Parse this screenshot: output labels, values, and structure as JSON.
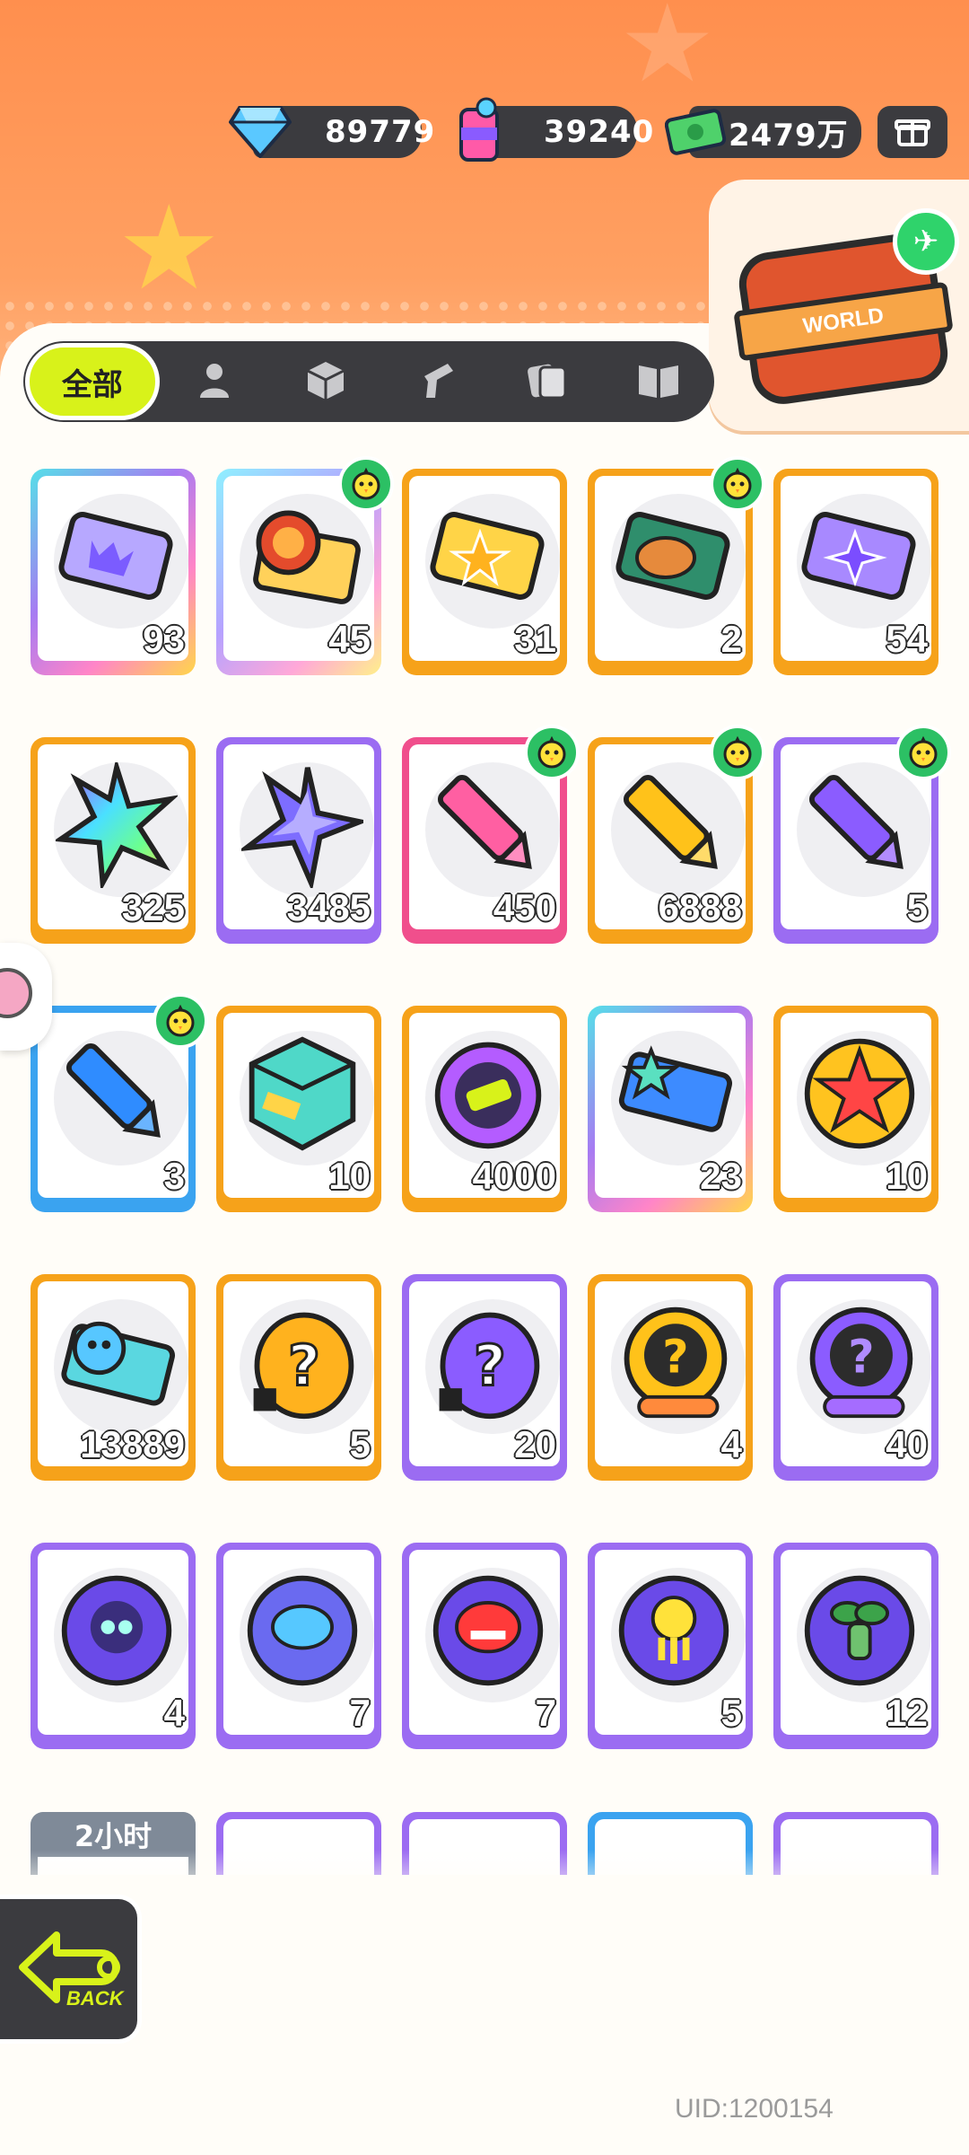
{
  "currencies": {
    "diamond": {
      "icon": "diamond-icon",
      "value": "89779"
    },
    "paint": {
      "icon": "paint-can-icon",
      "value": "39240"
    },
    "cash": {
      "icon": "cash-icon",
      "value": "2479万"
    }
  },
  "settings_icon": "gift-box-icon",
  "travel": {
    "label": "WORLD",
    "icon": "plane-icon"
  },
  "tabs": [
    {
      "label": "全部",
      "icon": null,
      "active": true
    },
    {
      "label": "",
      "icon": "person-icon"
    },
    {
      "label": "",
      "icon": "box-icon"
    },
    {
      "label": "",
      "icon": "paint-gun-icon"
    },
    {
      "label": "",
      "icon": "cards-icon"
    },
    {
      "label": "",
      "icon": "book-icon"
    }
  ],
  "items": [
    {
      "name": "purple-ticket",
      "count": "93",
      "frame": "c-rainbow",
      "badge": false,
      "icon": "ticket-crown-icon"
    },
    {
      "name": "lion-ticket",
      "count": "45",
      "frame": "c-rainbow2",
      "badge": true,
      "icon": "lion-ticket-icon"
    },
    {
      "name": "gold-ticket",
      "count": "31",
      "frame": "c-orange",
      "badge": false,
      "icon": "star-ticket-icon"
    },
    {
      "name": "bread-ticket",
      "count": "2",
      "frame": "c-orange",
      "badge": true,
      "icon": "bread-ticket-icon"
    },
    {
      "name": "violet-ticket",
      "count": "54",
      "frame": "c-orange",
      "badge": false,
      "icon": "sparkle-ticket-icon"
    },
    {
      "name": "rainbow-star",
      "count": "325",
      "frame": "c-orange",
      "badge": false,
      "icon": "rainbow-star-icon"
    },
    {
      "name": "purple-star",
      "count": "3485",
      "frame": "c-purple",
      "badge": false,
      "icon": "purple-star-icon"
    },
    {
      "name": "pink-crayon",
      "count": "450",
      "frame": "c-pink",
      "badge": true,
      "icon": "pink-crayon-icon"
    },
    {
      "name": "yellow-crayon",
      "count": "6888",
      "frame": "c-orange",
      "badge": true,
      "icon": "yellow-crayon-icon"
    },
    {
      "name": "purple-crayon",
      "count": "5",
      "frame": "c-purple",
      "badge": true,
      "icon": "purple-crayon-icon"
    },
    {
      "name": "blue-crayon",
      "count": "3",
      "frame": "c-blue",
      "badge": true,
      "icon": "blue-crayon-icon"
    },
    {
      "name": "color-block",
      "count": "10",
      "frame": "c-orange",
      "badge": false,
      "icon": "color-block-icon"
    },
    {
      "name": "cool-badge",
      "count": "4000",
      "frame": "c-orange",
      "badge": false,
      "icon": "cool-badge-icon"
    },
    {
      "name": "lottery-ticket",
      "count": "23",
      "frame": "c-rainbow",
      "badge": false,
      "icon": "lottery-ticket-icon"
    },
    {
      "name": "star-badge",
      "count": "10",
      "frame": "c-orange",
      "badge": false,
      "icon": "star-badge-icon"
    },
    {
      "name": "season-ticket",
      "count": "13889",
      "frame": "c-orange",
      "badge": false,
      "icon": "season-ticket-icon"
    },
    {
      "name": "gold-egg",
      "count": "5",
      "frame": "c-orange",
      "badge": false,
      "icon": "mystery-egg-gold-icon"
    },
    {
      "name": "purple-egg",
      "count": "20",
      "frame": "c-purple",
      "badge": false,
      "icon": "mystery-egg-purple-icon"
    },
    {
      "name": "gold-deity",
      "count": "4",
      "frame": "c-orange",
      "badge": false,
      "icon": "deity-gold-icon"
    },
    {
      "name": "purple-deity",
      "count": "40",
      "frame": "c-purple",
      "badge": false,
      "icon": "deity-purple-icon"
    },
    {
      "name": "bat-pet-orb",
      "count": "4",
      "frame": "c-purple",
      "badge": false,
      "icon": "bat-orb-icon"
    },
    {
      "name": "fish-pet-orb",
      "count": "7",
      "frame": "c-purple",
      "badge": false,
      "icon": "fish-orb-icon"
    },
    {
      "name": "piranha-pet-orb",
      "count": "7",
      "frame": "c-purple",
      "badge": false,
      "icon": "piranha-orb-icon"
    },
    {
      "name": "jelly-pet-orb",
      "count": "5",
      "frame": "c-purple",
      "badge": false,
      "icon": "jelly-orb-icon"
    },
    {
      "name": "sprout-pet-orb",
      "count": "12",
      "frame": "c-purple",
      "badge": false,
      "icon": "sprout-orb-icon"
    }
  ],
  "partial_row": {
    "timer_label": "2小时"
  },
  "back": {
    "label": "BACK",
    "icon": "back-arrow-icon"
  },
  "uid": "UID:1200154",
  "colors": {
    "accent": "#d8f21a",
    "orange": "#f6a21a",
    "purple": "#9b6cf2",
    "pink": "#f04f8c",
    "blue": "#3aa3f0",
    "dark": "#3b3b3f"
  }
}
